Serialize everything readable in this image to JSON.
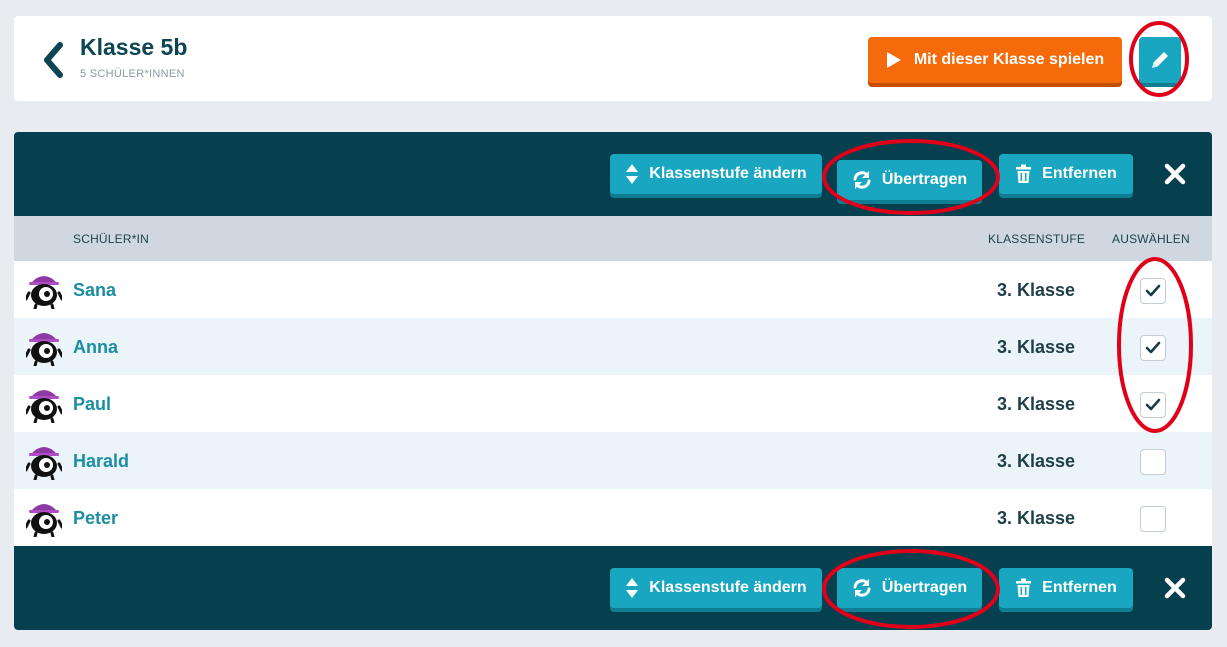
{
  "header": {
    "title": "Klasse 5b",
    "subtitle": "5 SCHÜLER*INNEN",
    "play_label": "Mit dieser Klasse spielen"
  },
  "toolbar": {
    "change_grade_label": "Klassenstufe ändern",
    "transfer_label": "Übertragen",
    "remove_label": "Entfernen"
  },
  "table": {
    "columns": [
      "SCHÜLER*IN",
      "KLASSENSTUFE",
      "AUSWÄHLEN"
    ],
    "rows": [
      {
        "name": "Sana",
        "grade": "3. Klasse",
        "selected": true
      },
      {
        "name": "Anna",
        "grade": "3. Klasse",
        "selected": true
      },
      {
        "name": "Paul",
        "grade": "3. Klasse",
        "selected": true
      },
      {
        "name": "Harald",
        "grade": "3. Klasse",
        "selected": false
      },
      {
        "name": "Peter",
        "grade": "3. Klasse",
        "selected": false
      }
    ]
  },
  "colors": {
    "primary_dark": "#063f4d",
    "accent_teal": "#19a6c0",
    "accent_orange": "#f56a0b",
    "annotation_red": "#e0001a"
  },
  "icons": {
    "back": "chevron-left-icon",
    "play": "play-icon",
    "edit": "pencil-icon",
    "change_grade": "sort-arrows-icon",
    "transfer": "refresh-icon",
    "remove": "trash-icon",
    "close": "close-icon",
    "check": "checkmark-icon",
    "avatar": "monster-avatar-icon"
  }
}
